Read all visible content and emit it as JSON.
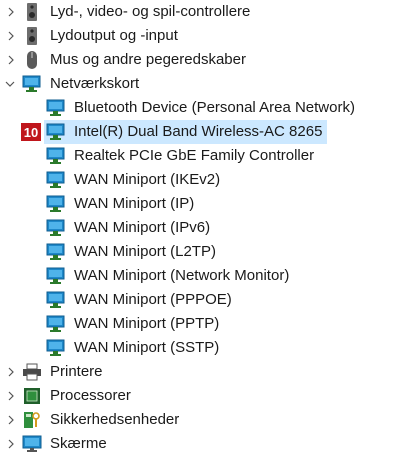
{
  "device_manager": {
    "categories": [
      {
        "label": "Lyd-, video- og spil-controllere",
        "icon": "speaker-icon"
      },
      {
        "label": "Lydoutput og -input",
        "icon": "speaker-icon"
      },
      {
        "label": "Mus og andre pegeredskaber",
        "icon": "mouse-icon"
      },
      {
        "label": "Netværkskort",
        "icon": "network-adapter-icon"
      }
    ],
    "network_adapters": [
      {
        "label": "Bluetooth Device (Personal Area Network)"
      },
      {
        "label": "Intel(R) Dual Band Wireless-AC 8265",
        "badge": "10"
      },
      {
        "label": "Realtek PCIe GbE Family Controller"
      },
      {
        "label": "WAN Miniport (IKEv2)"
      },
      {
        "label": "WAN Miniport (IP)"
      },
      {
        "label": "WAN Miniport (IPv6)"
      },
      {
        "label": "WAN Miniport (L2TP)"
      },
      {
        "label": "WAN Miniport (Network Monitor)"
      },
      {
        "label": "WAN Miniport (PPPOE)"
      },
      {
        "label": "WAN Miniport (PPTP)"
      },
      {
        "label": "WAN Miniport (SSTP)"
      }
    ],
    "categories_after": [
      {
        "label": "Printere",
        "icon": "printer-icon"
      },
      {
        "label": "Processorer",
        "icon": "processor-icon"
      },
      {
        "label": "Sikkerhedsenheder",
        "icon": "security-device-icon"
      },
      {
        "label": "Skærme",
        "icon": "monitor-icon"
      }
    ]
  },
  "colors": {
    "selection": "#cce8ff",
    "badge": "#c0161c",
    "adapter_blue": "#1e88c9"
  }
}
